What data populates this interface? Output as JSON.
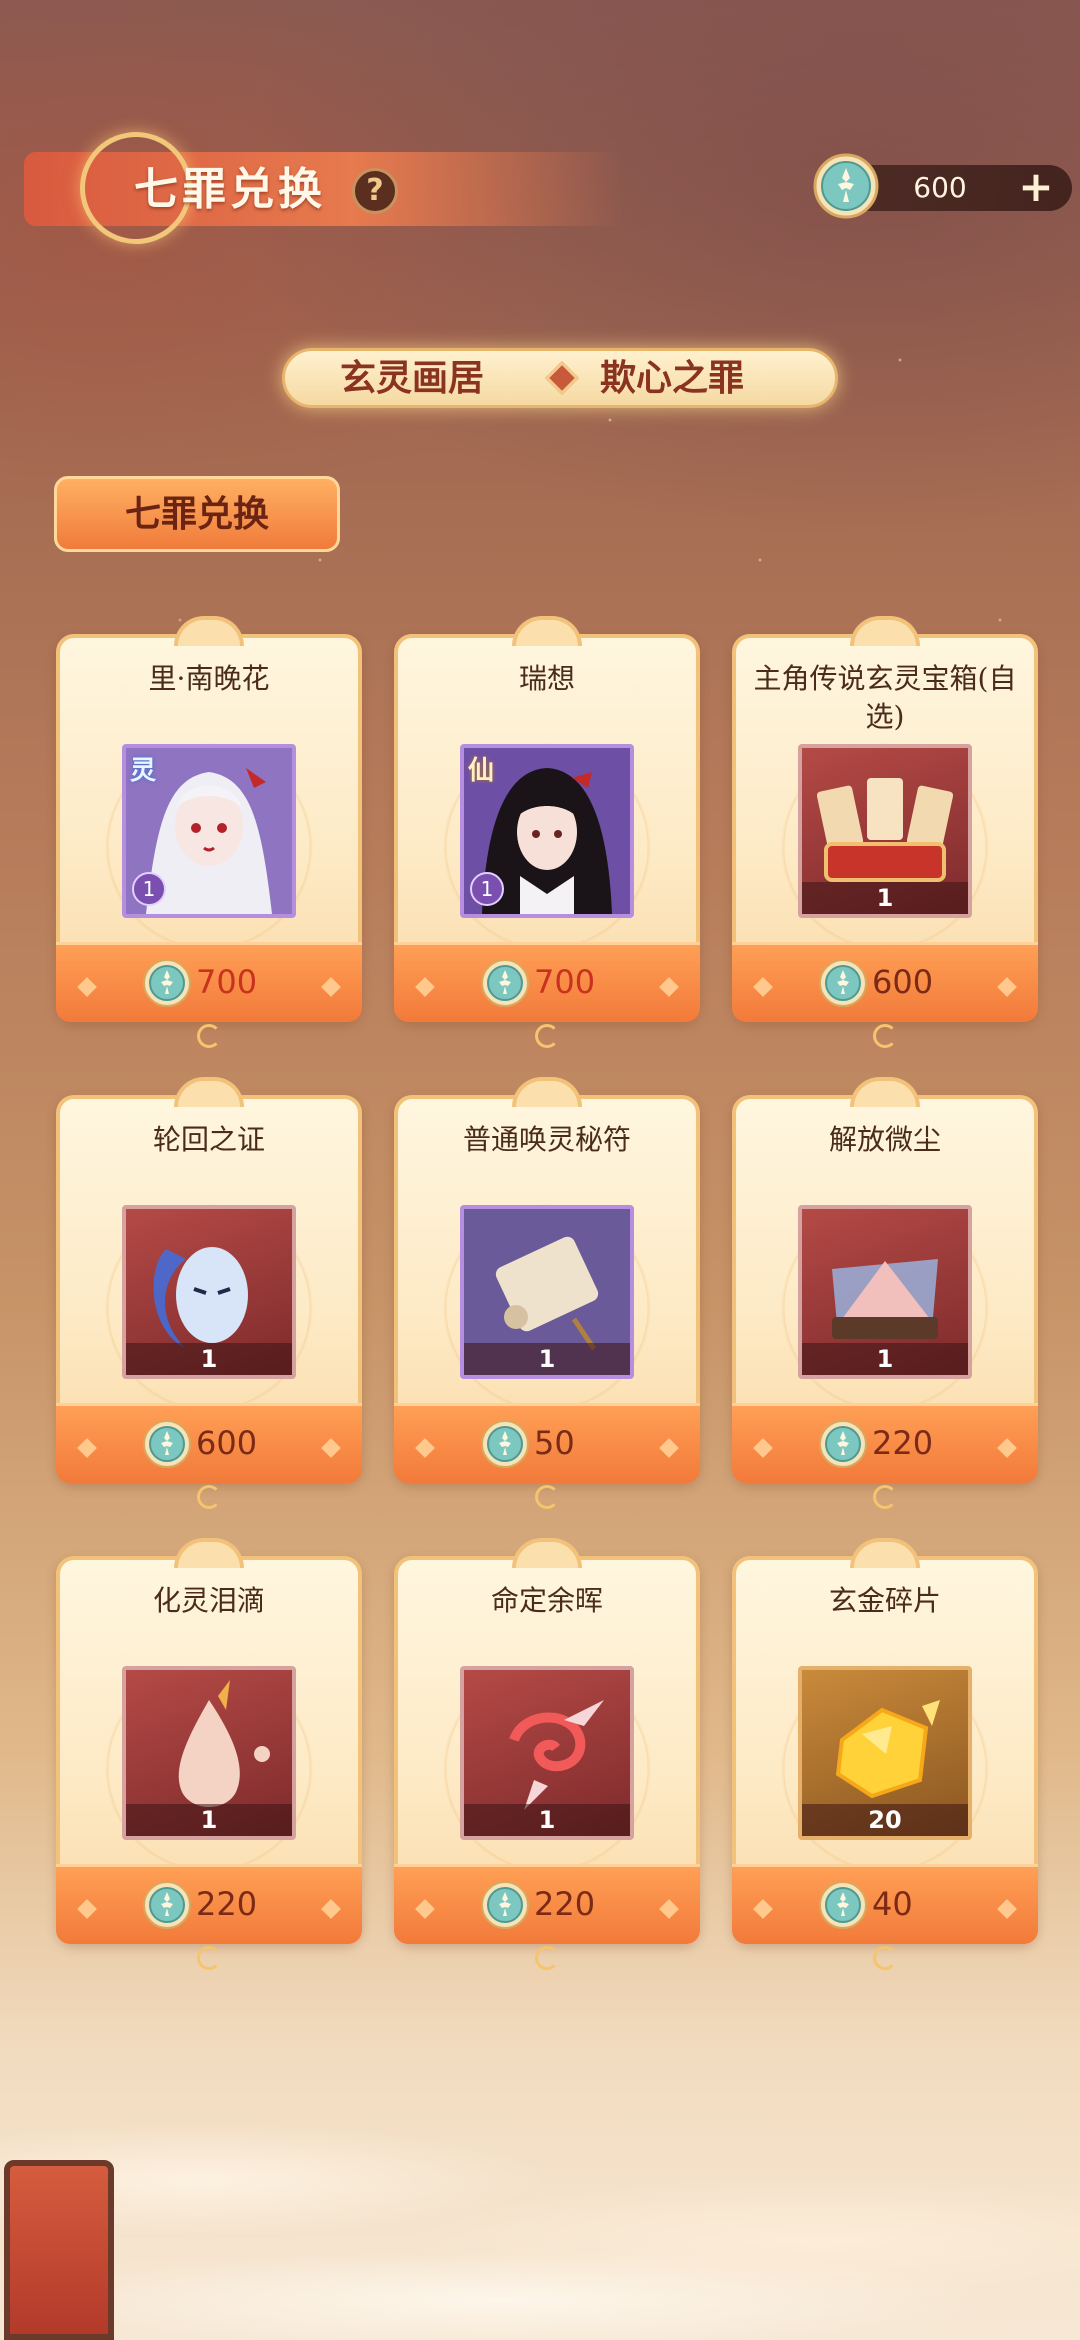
{
  "header": {
    "title": "七罪兑换",
    "help_label": "?",
    "currency": {
      "value": "600",
      "plus_label": "+"
    }
  },
  "sub_nav": {
    "left": "玄灵画居",
    "right": "欺心之罪"
  },
  "section_tab": "七罪兑换",
  "items": [
    {
      "name": "里·南晚花",
      "price": "700",
      "price_style": "hot",
      "badge": "灵",
      "level": "1"
    },
    {
      "name": "瑞想",
      "price": "700",
      "price_style": "hot",
      "badge": "仙",
      "level": "1"
    },
    {
      "name": "主角传说玄灵宝箱(自选)",
      "price": "600",
      "qty": "1"
    },
    {
      "name": "轮回之证",
      "price": "600",
      "qty": "1"
    },
    {
      "name": "普通唤灵秘符",
      "price": "50",
      "qty": "1"
    },
    {
      "name": "解放微尘",
      "price": "220",
      "qty": "1"
    },
    {
      "name": "化灵泪滴",
      "price": "220",
      "qty": "1"
    },
    {
      "name": "命定余晖",
      "price": "220",
      "qty": "1"
    },
    {
      "name": "玄金碎片",
      "price": "40",
      "qty": "20"
    }
  ],
  "colors": {
    "accent_orange": "#f27a3a",
    "price_hot": "#c8321e",
    "price_normal": "#7a2a16",
    "coin_teal": "#7cc7bf"
  }
}
